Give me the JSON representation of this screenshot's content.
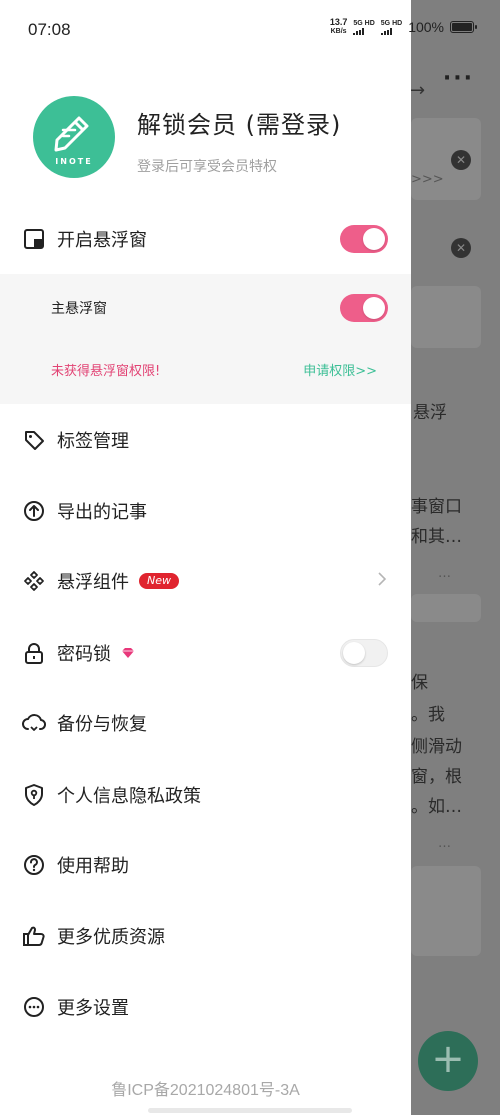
{
  "status": {
    "time": "07:08",
    "speed_value": "13.7",
    "speed_unit": "KB/s",
    "sim1": "5G HD",
    "sim2": "5G HD",
    "battery": "100%"
  },
  "profile": {
    "title": "解锁会员 (需登录)",
    "subtitle": "登录后可享受会员特权",
    "avatar_text": "INOTE"
  },
  "menu": {
    "float_window": {
      "label": "开启悬浮窗",
      "toggle": "on"
    },
    "main_float": {
      "label": "主悬浮窗",
      "toggle": "on"
    },
    "permission_warning": "未获得悬浮窗权限!",
    "apply_permission": "申请权限>>",
    "tags": "标签管理",
    "export": "导出的记事",
    "widgets": {
      "label": "悬浮组件",
      "badge": "New"
    },
    "password_lock": {
      "label": "密码锁",
      "toggle": "off"
    },
    "backup": "备份与恢复",
    "privacy": "个人信息隐私政策",
    "help": "使用帮助",
    "more_resources": "更多优质资源",
    "more_settings": "更多设置"
  },
  "footer": {
    "icp": "鲁ICP备2021024801号-3A"
  },
  "background": {
    "snippet_1": ">>>",
    "snippet_2": "悬浮",
    "snippet_3": "事窗口",
    "snippet_4": "和其…",
    "snippet_5": "…",
    "snippet_6": "保",
    "snippet_7": "。我",
    "snippet_8": "侧滑动",
    "snippet_9": "窗，根",
    "snippet_10": "。如…",
    "snippet_11": "…",
    "fab": "+"
  },
  "colors": {
    "accent_green": "#3dbf96",
    "toggle_pink": "#ee5e8a",
    "warning_red": "#e24374",
    "badge_red": "#e0242f"
  }
}
